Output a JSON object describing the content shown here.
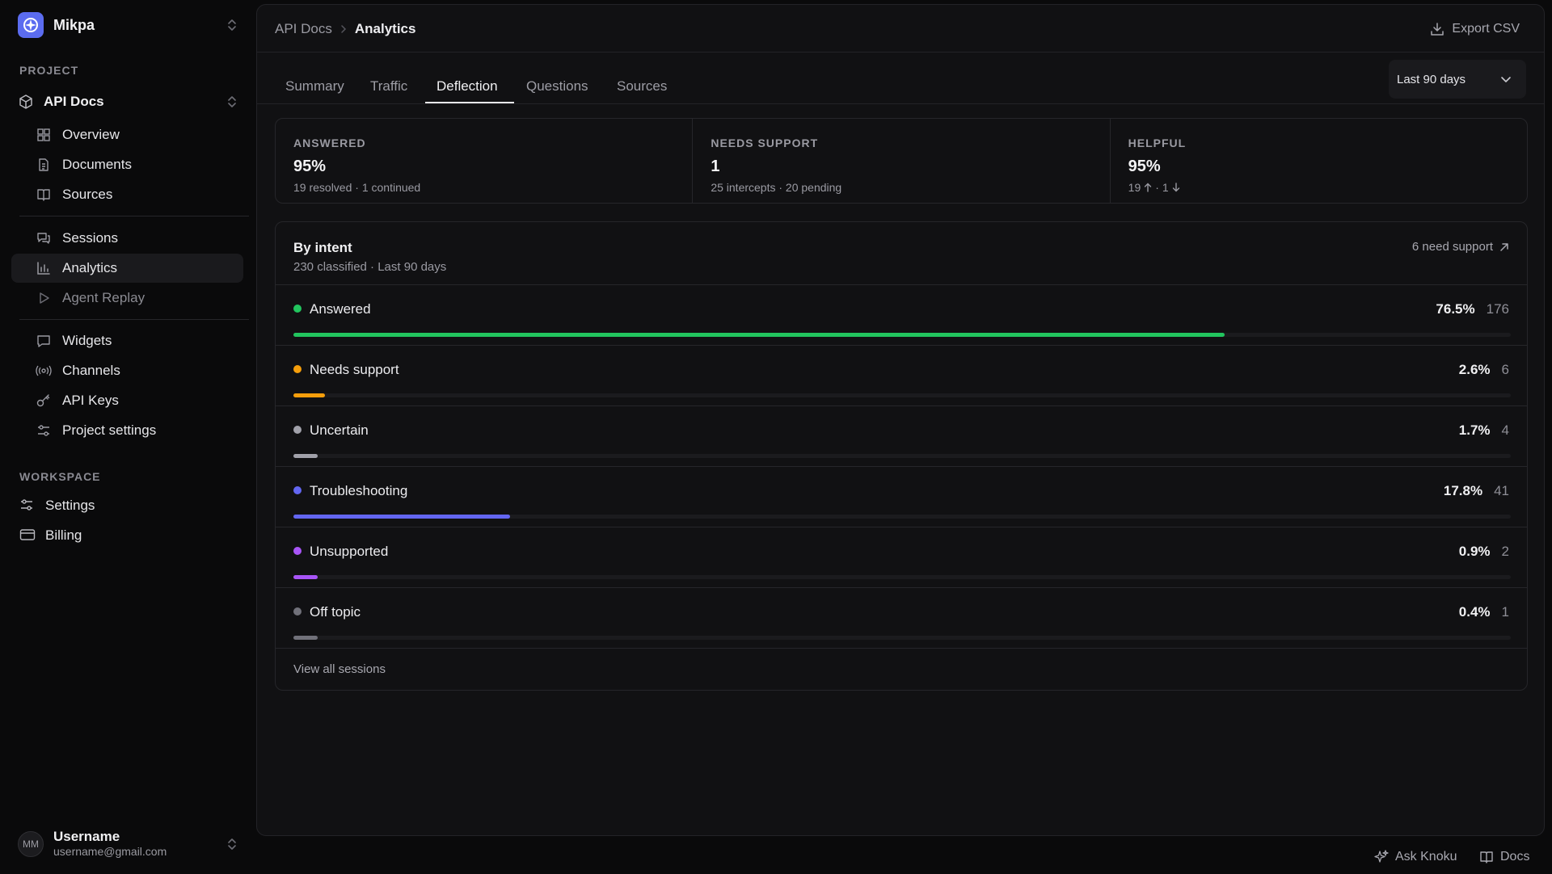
{
  "org": {
    "name": "Mikpa"
  },
  "sidebar": {
    "project_label": "PROJECT",
    "project_name": "API Docs",
    "group1": [
      {
        "label": "Overview",
        "icon": "grid-icon"
      },
      {
        "label": "Documents",
        "icon": "document-icon"
      },
      {
        "label": "Sources",
        "icon": "book-icon"
      }
    ],
    "group2": [
      {
        "label": "Sessions",
        "icon": "chat-bubbles-icon"
      },
      {
        "label": "Analytics",
        "icon": "bar-chart-icon"
      },
      {
        "label": "Agent Replay",
        "icon": "play-icon"
      }
    ],
    "group3": [
      {
        "label": "Widgets",
        "icon": "message-square-icon"
      },
      {
        "label": "Channels",
        "icon": "broadcast-icon"
      },
      {
        "label": "API Keys",
        "icon": "key-icon"
      },
      {
        "label": "Project settings",
        "icon": "sliders-icon"
      }
    ],
    "workspace_label": "WORKSPACE",
    "workspace": [
      {
        "label": "Settings",
        "icon": "sliders-icon"
      },
      {
        "label": "Billing",
        "icon": "credit-card-icon"
      }
    ]
  },
  "user": {
    "initials": "MM",
    "name": "Username",
    "email": "username@gmail.com"
  },
  "header": {
    "breadcrumb_parent": "API Docs",
    "breadcrumb_current": "Analytics",
    "export_label": "Export CSV"
  },
  "tabs": [
    "Summary",
    "Traffic",
    "Deflection",
    "Questions",
    "Sources"
  ],
  "active_tab": "Deflection",
  "range": {
    "selected": "Last 90 days"
  },
  "stats": [
    {
      "label": "ANSWERED",
      "value": "95%",
      "sub": "19 resolved · 1 continued"
    },
    {
      "label": "NEEDS SUPPORT",
      "value": "1",
      "sub": "25 intercepts · 20 pending"
    },
    {
      "label": "HELPFUL",
      "value": "95%",
      "sub_up": "19",
      "sub_sep": "·",
      "sub_down": "1"
    }
  ],
  "intent": {
    "title": "By intent",
    "subtitle": "230 classified · Last 90 days",
    "need_support_link": "6 need support",
    "rows": [
      {
        "label": "Answered",
        "pct": "76.5%",
        "count": "176",
        "fraction": 0.765,
        "color": "#22c55e",
        "track_fraction": 0.765
      },
      {
        "label": "Needs support",
        "pct": "2.6%",
        "count": "6",
        "fraction": 0.026,
        "color": "#f59e0b"
      },
      {
        "label": "Uncertain",
        "pct": "1.7%",
        "count": "4",
        "fraction": 0.017,
        "color": "#a1a1aa"
      },
      {
        "label": "Troubleshooting",
        "pct": "17.8%",
        "count": "41",
        "fraction": 0.178,
        "color": "#6366f1"
      },
      {
        "label": "Unsupported",
        "pct": "0.9%",
        "count": "2",
        "fraction": 0.009,
        "color": "#a855f7"
      },
      {
        "label": "Off topic",
        "pct": "0.4%",
        "count": "1",
        "fraction": 0.004,
        "color": "#71717a"
      }
    ],
    "view_all": "View all sessions"
  },
  "footer": {
    "ask_label": "Ask Knoku",
    "docs_label": "Docs"
  }
}
